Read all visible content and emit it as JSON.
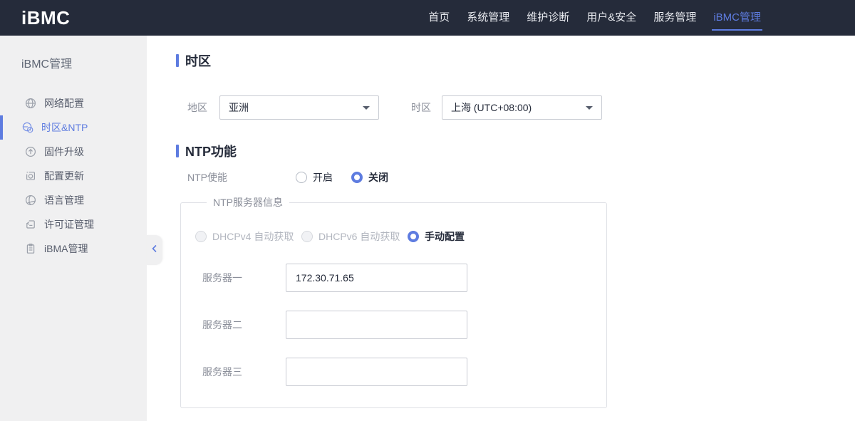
{
  "header": {
    "logo": "iBMC",
    "nav": [
      {
        "label": "首页",
        "active": false
      },
      {
        "label": "系统管理",
        "active": false
      },
      {
        "label": "维护诊断",
        "active": false
      },
      {
        "label": "用户&安全",
        "active": false
      },
      {
        "label": "服务管理",
        "active": false
      },
      {
        "label": "iBMC管理",
        "active": true
      }
    ]
  },
  "sidebar": {
    "title": "iBMC管理",
    "items": [
      {
        "label": "网络配置",
        "icon": "network-icon",
        "active": false
      },
      {
        "label": "时区&NTP",
        "icon": "timezone-ntp-icon",
        "active": true
      },
      {
        "label": "固件升级",
        "icon": "firmware-upgrade-icon",
        "active": false
      },
      {
        "label": "配置更新",
        "icon": "config-update-icon",
        "active": false
      },
      {
        "label": "语言管理",
        "icon": "language-icon",
        "active": false
      },
      {
        "label": "许可证管理",
        "icon": "license-icon",
        "active": false
      },
      {
        "label": "iBMA管理",
        "icon": "ibma-icon",
        "active": false
      }
    ],
    "collapse_icon": "chevron-left"
  },
  "main": {
    "timezone": {
      "title": "时区",
      "region_label": "地区",
      "region_value": "亚洲",
      "tz_label": "时区",
      "tz_value": "上海 (UTC+08:00)"
    },
    "ntp": {
      "title": "NTP功能",
      "enable_label": "NTP使能",
      "enable_on": {
        "label": "开启",
        "selected": false
      },
      "enable_off": {
        "label": "关闭",
        "selected": true
      },
      "server_group_legend": "NTP服务器信息",
      "modes": [
        {
          "label": "DHCPv4 自动获取",
          "selected": false,
          "disabled": true
        },
        {
          "label": "DHCPv6 自动获取",
          "selected": false,
          "disabled": true
        },
        {
          "label": "手动配置",
          "selected": true,
          "disabled": false
        }
      ],
      "servers": [
        {
          "label": "服务器一",
          "value": "172.30.71.65"
        },
        {
          "label": "服务器二",
          "value": ""
        },
        {
          "label": "服务器三",
          "value": ""
        }
      ]
    }
  },
  "colors": {
    "header_bg": "#252b3a",
    "accent_blue": "#5e7ce0",
    "sidebar_bg": "#f0f0f1",
    "label_gray": "#8a8e99"
  }
}
